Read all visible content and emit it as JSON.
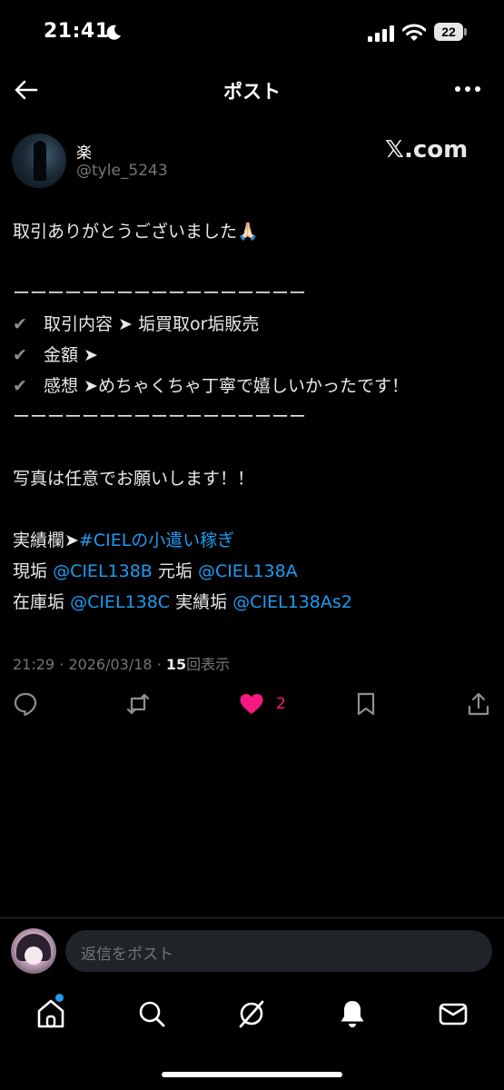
{
  "status_bar": {
    "time": "21:41",
    "battery": "22"
  },
  "header": {
    "title": "ポスト"
  },
  "author": {
    "display_name": "楽",
    "handle": "@tyle_5243",
    "watermark": "𝕏.com"
  },
  "post": {
    "line1": "取引ありがとうございました🙏🏻",
    "divider": "ーーーーーーーーーーーーーーーーー",
    "check_items": [
      {
        "check": "✔",
        "text": "取引内容 ➤ 垢買取or垢販売"
      },
      {
        "check": "✔",
        "text": "金額 ➤"
      },
      {
        "check": "✔",
        "text": "感想 ➤めちゃくちゃ丁寧で嬉しいかったです！"
      }
    ],
    "photo_note": "写真は任意でお願いします！！",
    "record_label": "実績欄➤",
    "record_hashtag": "#CIELの小遣い稼ぎ",
    "current_label": "現垢",
    "current_mention": "@CIEL138B",
    "former_label": "元垢",
    "former_mention": "@CIEL138A",
    "stock_label": "在庫垢",
    "stock_mention": "@CIEL138C",
    "track_label": "実績垢",
    "track_mention": "@CIEL138As2"
  },
  "meta": {
    "time": "21:29",
    "date": "2026/03/18",
    "views": "15",
    "views_label": "回表示",
    "sep": "·"
  },
  "actions": {
    "like_count": "2"
  },
  "reply": {
    "placeholder": "返信をポスト"
  },
  "colors": {
    "accent": "#1d9bf0",
    "like": "#f91880",
    "background": "#000000",
    "muted": "#71767b"
  }
}
